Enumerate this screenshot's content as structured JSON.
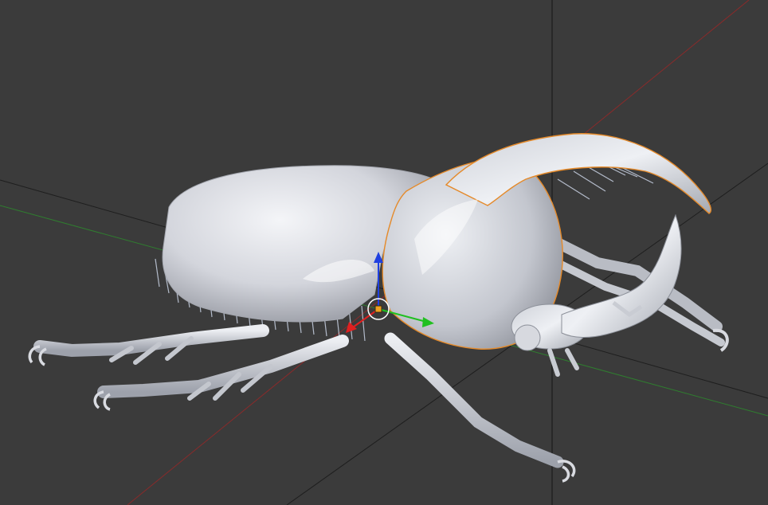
{
  "viewport": {
    "background_color": "#3b3b3b",
    "grid_line_color": "#1e1e1e",
    "axis_x_color": "#8a2a2a",
    "axis_y_color": "#2f7d2f",
    "selection_outline_color": "#e58a2a"
  },
  "model": {
    "object": "rhinoceros-beetle",
    "material_color": "#d6d8de",
    "hair_color": "#c9d2e4",
    "selected_part": "horned-pronotum"
  },
  "transform_gizmo": {
    "x_handle_color": "#e02020",
    "y_handle_color": "#20c020",
    "z_handle_color": "#2040e0",
    "pivot_color": "#f0a020"
  }
}
